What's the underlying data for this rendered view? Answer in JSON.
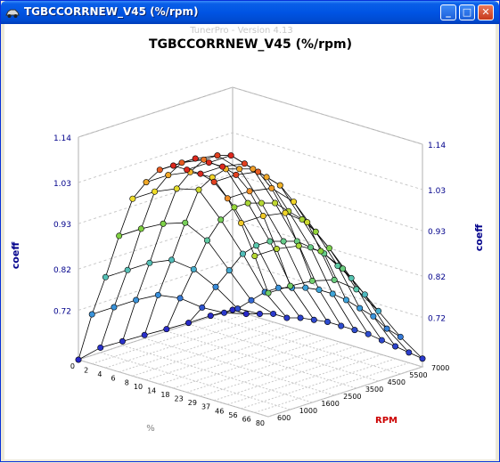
{
  "window": {
    "title": "TGBCCORRNEW_V45 (%/rpm)",
    "buttons": {
      "minimize": "_",
      "maximize": "□",
      "close": "✕"
    },
    "icon": "car-icon"
  },
  "chart": {
    "watermark": "TunerPro - Version 4.13",
    "title": "TGBCCORRNEW_V45 (%/rpm)",
    "zlabel_left": "coeff",
    "zlabel_right": "coeff",
    "xlabel": "%",
    "ylabel": "RPM"
  },
  "colors": {
    "title_bar": "#0054e3",
    "axis_blue": "#00008b",
    "axis_red": "#cc0000"
  },
  "chart_data": {
    "type": "surface",
    "title": "TGBCCORRNEW_V45 (%/rpm)",
    "x_label": "%",
    "y_label": "RPM",
    "z_label": "coeff",
    "x": [
      0,
      2,
      4,
      6,
      8,
      10,
      14,
      18,
      23,
      29,
      37,
      46,
      56,
      66,
      80
    ],
    "y": [
      600,
      1000,
      1600,
      2500,
      3500,
      4500,
      5500,
      7000
    ],
    "x_tick_labels": [
      "0",
      "2",
      "4",
      "6",
      "8",
      "10",
      "14",
      "18",
      "23",
      "29",
      "37",
      "46",
      "56",
      "66",
      "80"
    ],
    "y_tick_labels": [
      "600",
      "1000",
      "1600",
      "2500",
      "3500",
      "4500",
      "5500",
      "7000"
    ],
    "z_tick_labels": [
      "0.72",
      "0.82",
      "0.93",
      "1.03",
      "1.14"
    ],
    "z_range": [
      0.6,
      1.14
    ],
    "z": [
      [
        0.6,
        0.612,
        0.61,
        0.608,
        0.605,
        0.603,
        0.603,
        0.6
      ],
      [
        0.72,
        0.72,
        0.72,
        0.715,
        0.69,
        0.65,
        0.62,
        0.6
      ],
      [
        0.82,
        0.82,
        0.82,
        0.81,
        0.77,
        0.71,
        0.64,
        0.61
      ],
      [
        0.93,
        0.93,
        0.925,
        0.91,
        0.85,
        0.76,
        0.67,
        0.62
      ],
      [
        1.03,
        1.03,
        1.02,
        1.0,
        0.91,
        0.81,
        0.7,
        0.62
      ],
      [
        1.08,
        1.08,
        1.07,
        1.04,
        0.95,
        0.84,
        0.72,
        0.63
      ],
      [
        1.12,
        1.12,
        1.11,
        1.07,
        0.97,
        0.86,
        0.73,
        0.635
      ],
      [
        1.14,
        1.14,
        1.13,
        1.08,
        0.98,
        0.87,
        0.74,
        0.64
      ],
      [
        1.14,
        1.14,
        1.14,
        1.09,
        0.99,
        0.88,
        0.745,
        0.64
      ],
      [
        1.14,
        1.14,
        1.13,
        1.08,
        0.98,
        0.875,
        0.745,
        0.64
      ],
      [
        1.13,
        1.13,
        1.12,
        1.07,
        0.97,
        0.87,
        0.74,
        0.64
      ],
      [
        1.1,
        1.1,
        1.09,
        1.04,
        0.95,
        0.85,
        0.73,
        0.635
      ],
      [
        1.05,
        1.05,
        1.04,
        1.0,
        0.92,
        0.83,
        0.72,
        0.63
      ],
      [
        0.98,
        0.98,
        0.97,
        0.94,
        0.88,
        0.8,
        0.7,
        0.625
      ],
      [
        0.9,
        0.9,
        0.895,
        0.88,
        0.84,
        0.77,
        0.69,
        0.62
      ]
    ]
  }
}
